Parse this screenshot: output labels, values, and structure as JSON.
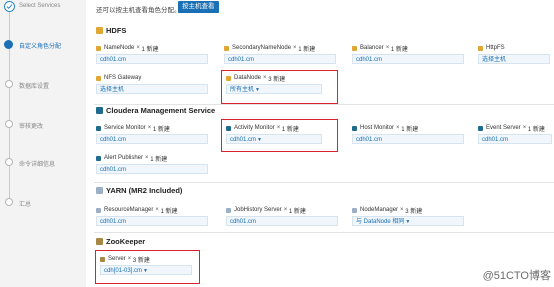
{
  "steps": [
    {
      "label": "Select Services",
      "state": "done"
    },
    {
      "label": "自定义角色分配",
      "state": "active"
    },
    {
      "label": "数据库设置",
      "state": "todo"
    },
    {
      "label": "审核更改",
      "state": "todo"
    },
    {
      "label": "命令详细信息",
      "state": "todo"
    },
    {
      "label": "汇总",
      "state": "todo"
    }
  ],
  "top": {
    "note": "还可以按主机查看角色分配。",
    "button": "按主机查看"
  },
  "sections": {
    "hdfs": {
      "title": "HDFS"
    },
    "cms": {
      "title": "Cloudera Management Service"
    },
    "yarn": {
      "title": "YARN (MR2 Included)"
    },
    "zk": {
      "title": "ZooKeeper"
    }
  },
  "roles": {
    "namenode": {
      "name": "NameNode",
      "count": "1 新建",
      "value": "cdh01.cm"
    },
    "snn": {
      "name": "SecondaryNameNode",
      "count": "1 新建",
      "value": "cdh01.cm"
    },
    "balancer": {
      "name": "Balancer",
      "count": "1 新建",
      "value": "cdh01.cm"
    },
    "httpfs": {
      "name": "HttpFS",
      "count": "",
      "value": "选择主机"
    },
    "nfs": {
      "name": "NFS Gateway",
      "count": "",
      "value": "选择主机"
    },
    "datanode": {
      "name": "DataNode",
      "count": "3 新建",
      "value": "所有主机"
    },
    "svcmon": {
      "name": "Service Monitor",
      "count": "1 新建",
      "value": "cdh01.cm"
    },
    "actmon": {
      "name": "Activity Monitor",
      "count": "1 新建",
      "value": "cdh01.cm"
    },
    "hostmon": {
      "name": "Host Monitor",
      "count": "1 新建",
      "value": "cdh01.cm"
    },
    "evtsrv": {
      "name": "Event Server",
      "count": "1 新建",
      "value": "cdh01.cm"
    },
    "alertpub": {
      "name": "Alert Publisher",
      "count": "1 新建",
      "value": "cdh01.cm"
    },
    "rm": {
      "name": "ResourceManager",
      "count": "1 新建",
      "value": "cdh01.cm"
    },
    "jhs": {
      "name": "JobHistory Server",
      "count": "1 新建",
      "value": "cdh01.cm"
    },
    "nm": {
      "name": "NodeManager",
      "count": "3 新建",
      "value": "与 DataNode 相同"
    },
    "zkserver": {
      "name": "Server",
      "count": "3 新建",
      "value": "cdh[01-03].cm"
    }
  },
  "watermark": "@51CTO博客",
  "colors": {
    "accent": "#1a6fb5",
    "highlight": "#d9232e",
    "hdfs_icon": "#e0a733",
    "cms_icon": "#1f6c8f",
    "yarn_icon": "#9bb0c4",
    "zk_icon": "#a88646"
  }
}
